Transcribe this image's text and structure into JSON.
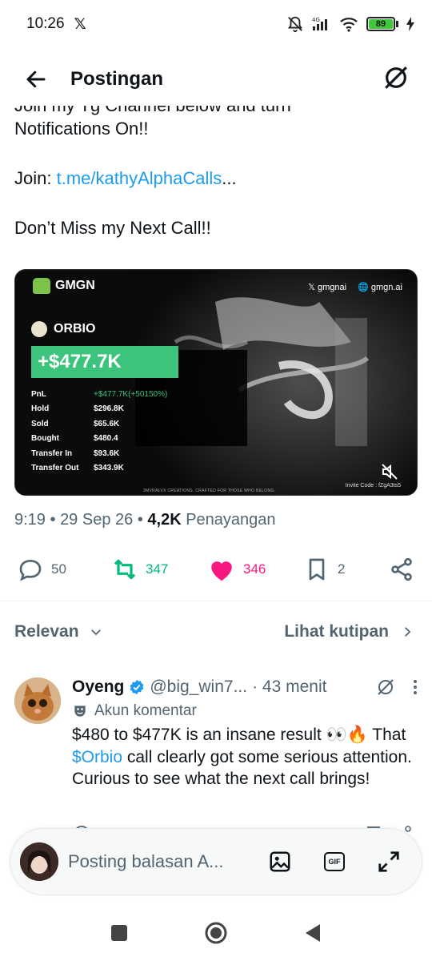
{
  "status_bar": {
    "time": "10:26",
    "app_glyph": "𝕏",
    "battery": "89"
  },
  "header": {
    "title": "Postingan"
  },
  "post": {
    "cut_line": "Join my Tg Channel below and turn",
    "line1": "Notifications On!!",
    "join_label": "Join: ",
    "join_link": "t.me/kathyAlphaCalls",
    "join_suffix": "...",
    "line3": "Don’t Miss my Next Call!!"
  },
  "card": {
    "brand": "GMGN",
    "x_handle": "gmgnai",
    "site": "gmgn.ai",
    "token": "ORBIO",
    "pnl": "+$477.7K",
    "stats": [
      {
        "label": "PnL",
        "value": "+$477.7K(+50150%)",
        "green": true
      },
      {
        "label": "Hold",
        "value": "$296.8K"
      },
      {
        "label": "Sold",
        "value": "$65.6K"
      },
      {
        "label": "Bought",
        "value": "$480.4"
      },
      {
        "label": "Transfer In",
        "value": "$93.6K"
      },
      {
        "label": "Transfer Out",
        "value": "$343.9K"
      }
    ],
    "invite": "Invite Code : fZgA3ts5",
    "credit": "3MVRALVX CREATIONS. CRAFTED FOR THOSE WHO BELONG."
  },
  "meta": {
    "time": "9:19",
    "date": "29 Sep 26",
    "views_count": "4,2K",
    "views_label": "Penayangan",
    "sep": " • "
  },
  "actions": {
    "replies": "50",
    "reposts": "347",
    "likes": "346",
    "bookmarks": "2"
  },
  "sort": {
    "relevance": "Relevan",
    "quotes": "Lihat kutipan"
  },
  "reply": {
    "name": "Oyeng",
    "handle": "@big_win7...",
    "time": "· 43 menit",
    "account_type": "Akun komentar",
    "text": "$480 to $477K is an insane result 👀🔥 That ",
    "cashtag": "$Orbio",
    "text2": " call clearly got some serious attention. Curious to see what the next call brings!"
  },
  "compose": {
    "placeholder": "Posting balasan A..."
  },
  "colors": {
    "link": "#1d9bf0",
    "repost": "#00ba7c",
    "like": "#f91880",
    "secondary": "#536471",
    "pnl_green": "#3cc47c"
  }
}
